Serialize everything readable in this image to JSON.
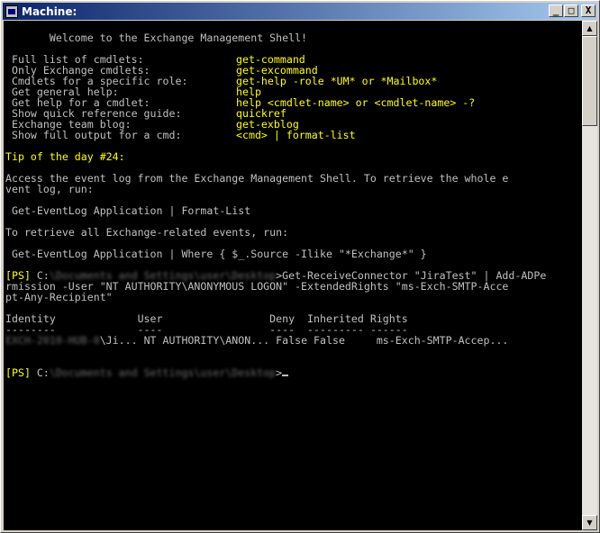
{
  "window": {
    "title": "Machine:"
  },
  "controls": {
    "minimize": "_",
    "maximize": "□",
    "close": "X"
  },
  "console": {
    "welcome": "       Welcome to the Exchange Management Shell!",
    "help": [
      {
        "label": " Full list of cmdlets:",
        "cmd": "get-command"
      },
      {
        "label": " Only Exchange cmdlets:",
        "cmd": "get-excommand"
      },
      {
        "label": " Cmdlets for a specific role:",
        "cmd": "get-help -role *UM* or *Mailbox*"
      },
      {
        "label": " Get general help:",
        "cmd": "help"
      },
      {
        "label": " Get help for a cmdlet:",
        "cmd": "help <cmdlet-name> or <cmdlet-name> -?"
      },
      {
        "label": " Show quick reference guide:",
        "cmd": "quickref"
      },
      {
        "label": " Exchange team blog:",
        "cmd": "get-exblog"
      },
      {
        "label": " Show full output for a cmd:",
        "cmd": "<cmd> | format-list"
      }
    ],
    "tip": "Tip of the day #24:",
    "tip_line1": "Access the event log from the Exchange Management Shell. To retrieve the whole e",
    "tip_line2": "vent log, run:",
    "tip_cmd1": " Get-EventLog Application | Format-List",
    "tip_line3": "To retrieve all Exchange-related events, run:",
    "tip_cmd2": " Get-EventLog Application | Where { $_.Source -Ilike \"*Exchange*\" }",
    "prompt_tag": "[PS]",
    "drive": " C:",
    "path_blurred": "\\Documents and Settings\\user\\Desktop",
    "command_part1": ">Get-ReceiveConnector \"JiraTest\" | Add-ADPe",
    "command_line2": "rmission -User \"NT AUTHORITY\\ANONYMOUS LOGON\" -ExtendedRights \"ms-Exch-SMTP-Acce",
    "command_line3": "pt-Any-Recipient\"",
    "table_header": "Identity             User                 Deny  Inherited Rights",
    "table_rule": "--------             ----                 ----  --------- ------",
    "row_blurred": "EXCH-2010-HUB-0",
    "row_rest": "\\Ji... NT AUTHORITY\\ANON... False False     ms-Exch-SMTP-Accep...",
    "prompt2_end": ">"
  }
}
